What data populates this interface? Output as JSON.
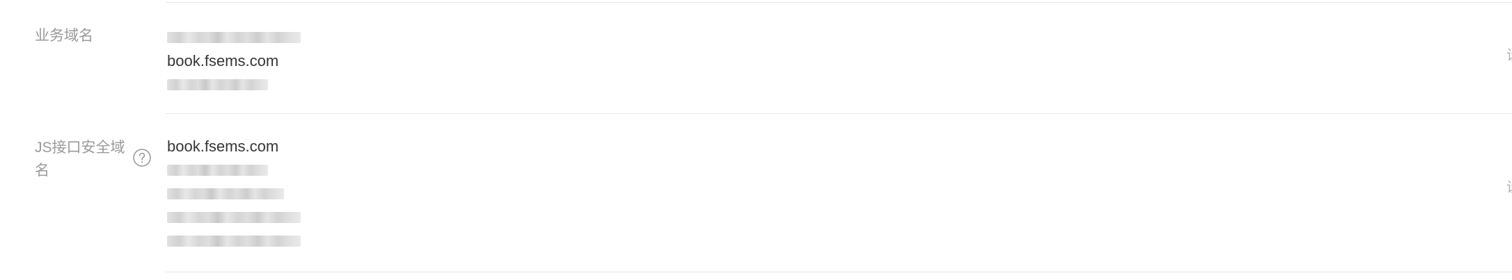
{
  "rows": [
    {
      "label": "业务域名",
      "domains": [
        "book.fsems.com"
      ]
    },
    {
      "label": "JS接口安全域名",
      "domains": [
        "book.fsems.com"
      ],
      "help_icon": "question-circle-icon"
    }
  ],
  "right_edge_glyph": "设"
}
